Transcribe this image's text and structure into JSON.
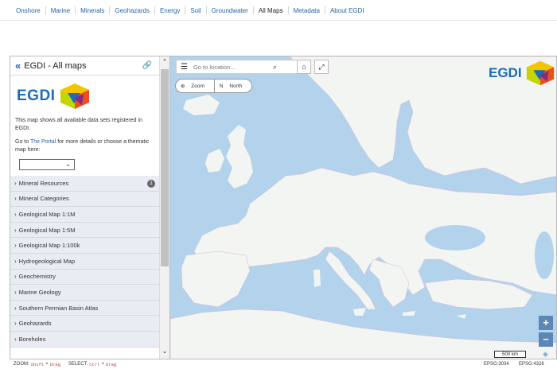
{
  "nav": {
    "items": [
      "Onshore",
      "Marine",
      "Minerals",
      "Geohazards",
      "Energy",
      "Soil",
      "Groundwater",
      "All Maps",
      "Metadata",
      "About EGDI"
    ],
    "active": "All Maps"
  },
  "sidebar": {
    "title": "EGDI - All maps",
    "logo_text": "EGDI",
    "desc1": "This map shows all available data sets registered in EGDI.",
    "desc2_pre": "Go to",
    "desc2_link": "The Portal",
    "desc2_post": "for more details or choose a thematic map here:",
    "select_value": "",
    "items": [
      {
        "label": "Mineral Resources",
        "badge": "1"
      },
      {
        "label": "Mineral Categories"
      },
      {
        "label": "Geological Map 1:1M"
      },
      {
        "label": "Geological Map 1:5M"
      },
      {
        "label": "Geological Map 1:100k"
      },
      {
        "label": "Hydrogeological Map"
      },
      {
        "label": "Geochemistry"
      },
      {
        "label": "Marine Geology"
      },
      {
        "label": "Southern Permian Basin Atlas"
      },
      {
        "label": "Geohazards"
      },
      {
        "label": "Boreholes"
      }
    ]
  },
  "map": {
    "search_placeholder": "Go to location...",
    "zoom_label": "Zoom",
    "north_label": "North",
    "logo_text": "EGDI",
    "scale_label": "500 km",
    "zoom_in": "+",
    "zoom_out": "−"
  },
  "footer": {
    "zoom_label": "ZOOM:",
    "zoom_key1": "Shift",
    "plus": "+",
    "zoom_key2": "Drag",
    "select_label": "SELECT:",
    "select_key1": "Ctrl",
    "select_key2": "Drag",
    "epsg1": "EPSG:3034",
    "epsg2": "EPSG:4326"
  },
  "colors": {
    "sea": "#b3d2ec",
    "land": "#f2f5f2",
    "accent": "#2a62a6"
  }
}
